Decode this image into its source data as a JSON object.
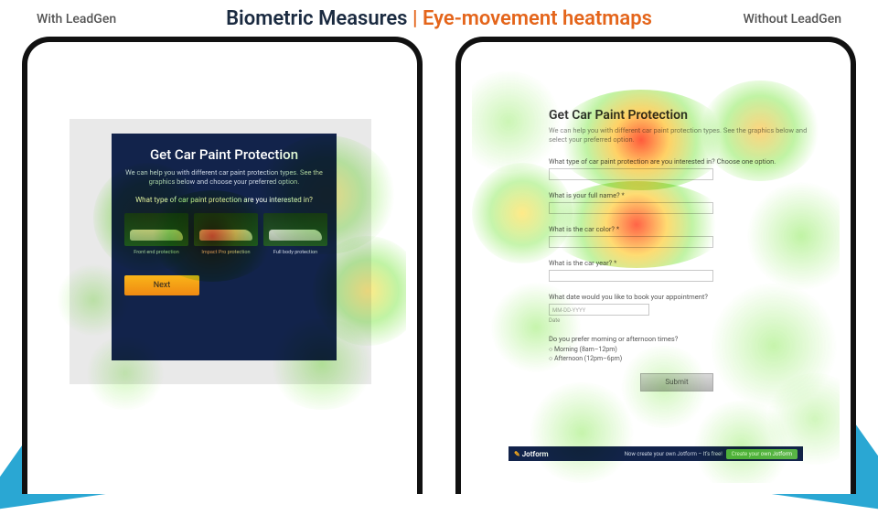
{
  "header": {
    "title_a": "Biometric Measures ",
    "sep": "| ",
    "title_b": "Eye-movement heatmaps",
    "left_label": "With LeadGen",
    "right_label": "Without LeadGen"
  },
  "left": {
    "heading": "Get Car Paint Protection",
    "desc": "We can help you with different car paint protection types. See the graphics below and choose your preferred option.",
    "question": "What type of car paint protection are you interested in?",
    "options": {
      "a": "Front end protection",
      "b": "Impact Pro protection",
      "c": "Full body protection"
    },
    "next": "Next"
  },
  "right": {
    "heading": "Get Car Paint Protection",
    "desc": "We can help you with different car paint protection types. See the graphics below and select your preferred option.",
    "q_type": "What type of car paint protection are you interested in? Choose one option.",
    "q_name": "What is your full name? *",
    "q_color": "What is the car color? *",
    "q_year": "What is the car year? *",
    "q_date": "What date would you like to book your appointment?",
    "date_ph": "MM-DD-YYYY",
    "date_hint": "Date",
    "q_time": "Do you prefer morning or afternoon times?",
    "opt_morning": "Morning (8am–12pm)",
    "opt_afternoon": "Afternoon (12pm–6pm)",
    "submit": "Submit",
    "jot_logo": "Jotform",
    "jot_txt": "Now create your own Jotform – It's free!",
    "jot_cta": "Create your own Jotform"
  }
}
